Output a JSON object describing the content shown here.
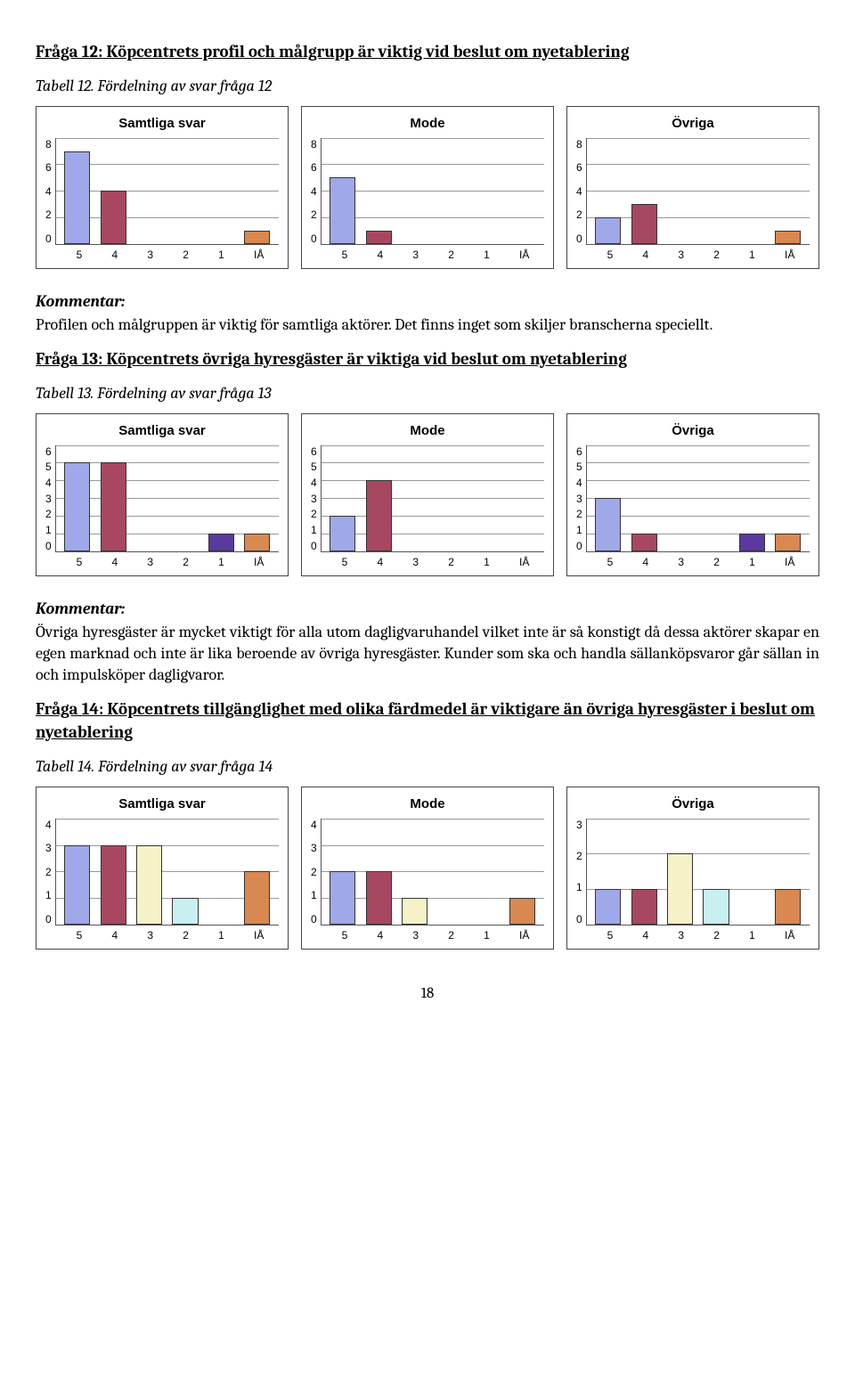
{
  "q12": {
    "heading": "Fråga 12: Köpcentrets profil och målgrupp är viktig vid beslut om nyetablering",
    "caption": "Tabell 12. Fördelning av svar fråga 12"
  },
  "kommentar_label": "Kommentar:",
  "k12_text": "Profilen och målgruppen är viktig för samtliga aktörer. Det finns inget som skiljer branscherna speciellt.",
  "q13": {
    "heading": "Fråga 13: Köpcentrets övriga hyresgäster är viktiga vid beslut om nyetablering",
    "caption": "Tabell 13. Fördelning av svar fråga 13"
  },
  "k13_text": "Övriga hyresgäster är mycket viktigt för alla utom dagligvaruhandel vilket inte är så konstigt då dessa aktörer skapar en egen marknad och inte är lika beroende av övriga hyresgäster. Kunder som ska och handla sällanköpsvaror går sällan in och impulsköper dagligvaror.",
  "q14": {
    "heading": "Fråga 14: Köpcentrets tillgänglighet med olika färdmedel är viktigare än övriga hyresgäster i beslut om nyetablering",
    "caption": "Tabell 14. Fördelning av svar fråga 14"
  },
  "chart_titles": {
    "samtliga": "Samtliga svar",
    "mode": "Mode",
    "ovriga": "Övriga"
  },
  "categories": [
    "5",
    "4",
    "3",
    "2",
    "1",
    "IÅ"
  ],
  "colors": [
    "#9fa8e8",
    "#a84860",
    "#f5f2c8",
    "#c8f0f0",
    "#5a3a9e",
    "#d88850"
  ],
  "chart_data": [
    {
      "question": 12,
      "type": "bar",
      "ylim": [
        0,
        8
      ],
      "yticks_key": "t12",
      "series": [
        {
          "name": "Samtliga svar",
          "values": [
            7,
            4,
            0,
            0,
            0,
            1
          ]
        },
        {
          "name": "Mode",
          "values": [
            5,
            1,
            0,
            0,
            0,
            0
          ]
        },
        {
          "name": "Övriga",
          "values": [
            2,
            3,
            0,
            0,
            0,
            1
          ]
        }
      ]
    },
    {
      "question": 13,
      "type": "bar",
      "ylim": [
        0,
        6
      ],
      "yticks_key": "t13",
      "series": [
        {
          "name": "Samtliga svar",
          "values": [
            5,
            5,
            0,
            0,
            1,
            1
          ]
        },
        {
          "name": "Mode",
          "values": [
            2,
            4,
            0,
            0,
            0,
            0
          ]
        },
        {
          "name": "Övriga",
          "values": [
            3,
            1,
            0,
            0,
            1,
            1
          ]
        }
      ]
    },
    {
      "question": 14,
      "type": "bar",
      "ylim_a": [
        0,
        4
      ],
      "ylim_c": [
        0,
        3
      ],
      "series": [
        {
          "name": "Samtliga svar",
          "values": [
            3,
            3,
            3,
            1,
            0,
            2
          ]
        },
        {
          "name": "Mode",
          "values": [
            2,
            2,
            1,
            0,
            0,
            1
          ]
        },
        {
          "name": "Övriga",
          "values": [
            1,
            1,
            2,
            1,
            0,
            1
          ]
        }
      ]
    }
  ],
  "yticks": {
    "t12": [
      "8",
      "6",
      "4",
      "2",
      "0"
    ],
    "t13": [
      "6",
      "5",
      "4",
      "3",
      "2",
      "1",
      "0"
    ],
    "t14a": [
      "4",
      "3",
      "2",
      "1",
      "0"
    ],
    "t14c": [
      "3",
      "2",
      "1",
      "0"
    ]
  },
  "page_number": "18"
}
